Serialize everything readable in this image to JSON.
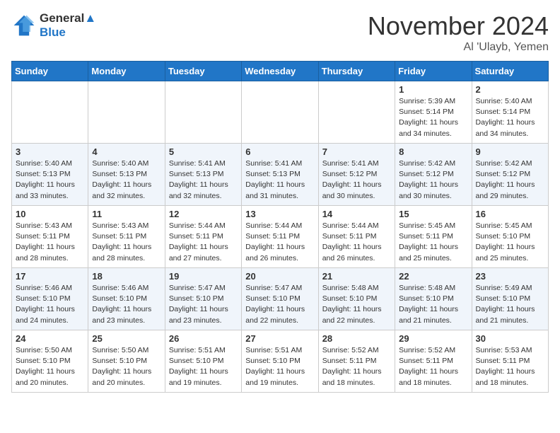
{
  "header": {
    "logo_line1": "General",
    "logo_line2": "Blue",
    "month": "November 2024",
    "location": "Al 'Ulayb, Yemen"
  },
  "weekdays": [
    "Sunday",
    "Monday",
    "Tuesday",
    "Wednesday",
    "Thursday",
    "Friday",
    "Saturday"
  ],
  "weeks": [
    [
      {
        "day": "",
        "info": ""
      },
      {
        "day": "",
        "info": ""
      },
      {
        "day": "",
        "info": ""
      },
      {
        "day": "",
        "info": ""
      },
      {
        "day": "",
        "info": ""
      },
      {
        "day": "1",
        "info": "Sunrise: 5:39 AM\nSunset: 5:14 PM\nDaylight: 11 hours\nand 34 minutes."
      },
      {
        "day": "2",
        "info": "Sunrise: 5:40 AM\nSunset: 5:14 PM\nDaylight: 11 hours\nand 34 minutes."
      }
    ],
    [
      {
        "day": "3",
        "info": "Sunrise: 5:40 AM\nSunset: 5:13 PM\nDaylight: 11 hours\nand 33 minutes."
      },
      {
        "day": "4",
        "info": "Sunrise: 5:40 AM\nSunset: 5:13 PM\nDaylight: 11 hours\nand 32 minutes."
      },
      {
        "day": "5",
        "info": "Sunrise: 5:41 AM\nSunset: 5:13 PM\nDaylight: 11 hours\nand 32 minutes."
      },
      {
        "day": "6",
        "info": "Sunrise: 5:41 AM\nSunset: 5:13 PM\nDaylight: 11 hours\nand 31 minutes."
      },
      {
        "day": "7",
        "info": "Sunrise: 5:41 AM\nSunset: 5:12 PM\nDaylight: 11 hours\nand 30 minutes."
      },
      {
        "day": "8",
        "info": "Sunrise: 5:42 AM\nSunset: 5:12 PM\nDaylight: 11 hours\nand 30 minutes."
      },
      {
        "day": "9",
        "info": "Sunrise: 5:42 AM\nSunset: 5:12 PM\nDaylight: 11 hours\nand 29 minutes."
      }
    ],
    [
      {
        "day": "10",
        "info": "Sunrise: 5:43 AM\nSunset: 5:11 PM\nDaylight: 11 hours\nand 28 minutes."
      },
      {
        "day": "11",
        "info": "Sunrise: 5:43 AM\nSunset: 5:11 PM\nDaylight: 11 hours\nand 28 minutes."
      },
      {
        "day": "12",
        "info": "Sunrise: 5:44 AM\nSunset: 5:11 PM\nDaylight: 11 hours\nand 27 minutes."
      },
      {
        "day": "13",
        "info": "Sunrise: 5:44 AM\nSunset: 5:11 PM\nDaylight: 11 hours\nand 26 minutes."
      },
      {
        "day": "14",
        "info": "Sunrise: 5:44 AM\nSunset: 5:11 PM\nDaylight: 11 hours\nand 26 minutes."
      },
      {
        "day": "15",
        "info": "Sunrise: 5:45 AM\nSunset: 5:11 PM\nDaylight: 11 hours\nand 25 minutes."
      },
      {
        "day": "16",
        "info": "Sunrise: 5:45 AM\nSunset: 5:10 PM\nDaylight: 11 hours\nand 25 minutes."
      }
    ],
    [
      {
        "day": "17",
        "info": "Sunrise: 5:46 AM\nSunset: 5:10 PM\nDaylight: 11 hours\nand 24 minutes."
      },
      {
        "day": "18",
        "info": "Sunrise: 5:46 AM\nSunset: 5:10 PM\nDaylight: 11 hours\nand 23 minutes."
      },
      {
        "day": "19",
        "info": "Sunrise: 5:47 AM\nSunset: 5:10 PM\nDaylight: 11 hours\nand 23 minutes."
      },
      {
        "day": "20",
        "info": "Sunrise: 5:47 AM\nSunset: 5:10 PM\nDaylight: 11 hours\nand 22 minutes."
      },
      {
        "day": "21",
        "info": "Sunrise: 5:48 AM\nSunset: 5:10 PM\nDaylight: 11 hours\nand 22 minutes."
      },
      {
        "day": "22",
        "info": "Sunrise: 5:48 AM\nSunset: 5:10 PM\nDaylight: 11 hours\nand 21 minutes."
      },
      {
        "day": "23",
        "info": "Sunrise: 5:49 AM\nSunset: 5:10 PM\nDaylight: 11 hours\nand 21 minutes."
      }
    ],
    [
      {
        "day": "24",
        "info": "Sunrise: 5:50 AM\nSunset: 5:10 PM\nDaylight: 11 hours\nand 20 minutes."
      },
      {
        "day": "25",
        "info": "Sunrise: 5:50 AM\nSunset: 5:10 PM\nDaylight: 11 hours\nand 20 minutes."
      },
      {
        "day": "26",
        "info": "Sunrise: 5:51 AM\nSunset: 5:10 PM\nDaylight: 11 hours\nand 19 minutes."
      },
      {
        "day": "27",
        "info": "Sunrise: 5:51 AM\nSunset: 5:10 PM\nDaylight: 11 hours\nand 19 minutes."
      },
      {
        "day": "28",
        "info": "Sunrise: 5:52 AM\nSunset: 5:11 PM\nDaylight: 11 hours\nand 18 minutes."
      },
      {
        "day": "29",
        "info": "Sunrise: 5:52 AM\nSunset: 5:11 PM\nDaylight: 11 hours\nand 18 minutes."
      },
      {
        "day": "30",
        "info": "Sunrise: 5:53 AM\nSunset: 5:11 PM\nDaylight: 11 hours\nand 18 minutes."
      }
    ]
  ]
}
